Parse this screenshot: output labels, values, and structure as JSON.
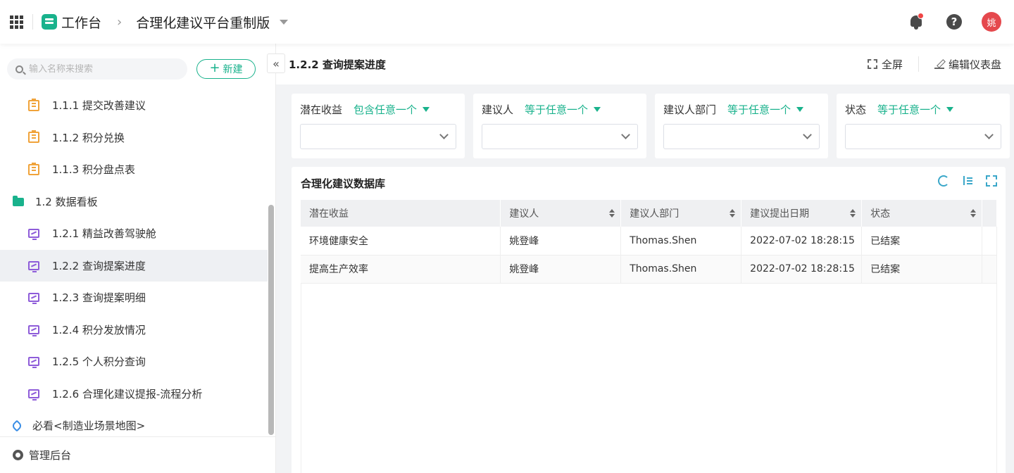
{
  "topbar": {
    "workspace_title": "工作台",
    "breadcrumb_sep": "›",
    "app_title": "合理化建议平台重制版",
    "avatar_text": "姚",
    "help_text": "?"
  },
  "sidebar": {
    "search_placeholder": "输入名称来搜索",
    "new_button": "新建",
    "items": [
      {
        "label": "1.1.1 提交改善建议",
        "icon": "form-icon",
        "level": 2
      },
      {
        "label": "1.1.2 积分兑换",
        "icon": "form-icon",
        "level": 2
      },
      {
        "label": "1.1.3 积分盘点表",
        "icon": "form-icon",
        "level": 2
      },
      {
        "label": "1.2 数据看板",
        "icon": "folder-icon",
        "level": 1
      },
      {
        "label": "1.2.1 精益改善驾驶舱",
        "icon": "dashboard-icon",
        "level": 2
      },
      {
        "label": "1.2.2 查询提案进度",
        "icon": "dashboard-icon",
        "level": 2,
        "active": true
      },
      {
        "label": "1.2.3 查询提案明细",
        "icon": "dashboard-icon",
        "level": 2
      },
      {
        "label": "1.2.4 积分发放情况",
        "icon": "dashboard-icon",
        "level": 2
      },
      {
        "label": "1.2.5 个人积分查询",
        "icon": "dashboard-icon",
        "level": 2
      },
      {
        "label": "1.2.6 合理化建议提报-流程分析",
        "icon": "dashboard-icon",
        "level": 2
      },
      {
        "label": "必看<制造业场景地图>",
        "icon": "tag-icon",
        "level": 1
      }
    ],
    "footer": "管理后台"
  },
  "main": {
    "page_title": "1.2.2 查询提案进度",
    "fullscreen_label": "全屏",
    "edit_label": "编辑仪表盘",
    "filters": [
      {
        "label": "潜在收益",
        "operator": "包含任意一个",
        "value": ""
      },
      {
        "label": "建议人",
        "operator": "等于任意一个",
        "value": ""
      },
      {
        "label": "建议人部门",
        "operator": "等于任意一个",
        "value": ""
      },
      {
        "label": "状态",
        "operator": "等于任意一个",
        "value": ""
      }
    ],
    "table": {
      "title": "合理化建议数据库",
      "columns": [
        "潜在收益",
        "建议人",
        "建议人部门",
        "建议提出日期",
        "状态"
      ],
      "rows": [
        [
          "环境健康安全",
          "姚登峰",
          "Thomas.Shen",
          "2022-07-02 18:28:15",
          "已结案"
        ],
        [
          "提高生产效率",
          "姚登峰",
          "Thomas.Shen",
          "2022-07-02 18:28:15",
          "已结案"
        ]
      ]
    }
  },
  "colors": {
    "brand": "#19b28c",
    "link": "#1e7ed8",
    "accent_icon": "#3aa7c9"
  }
}
